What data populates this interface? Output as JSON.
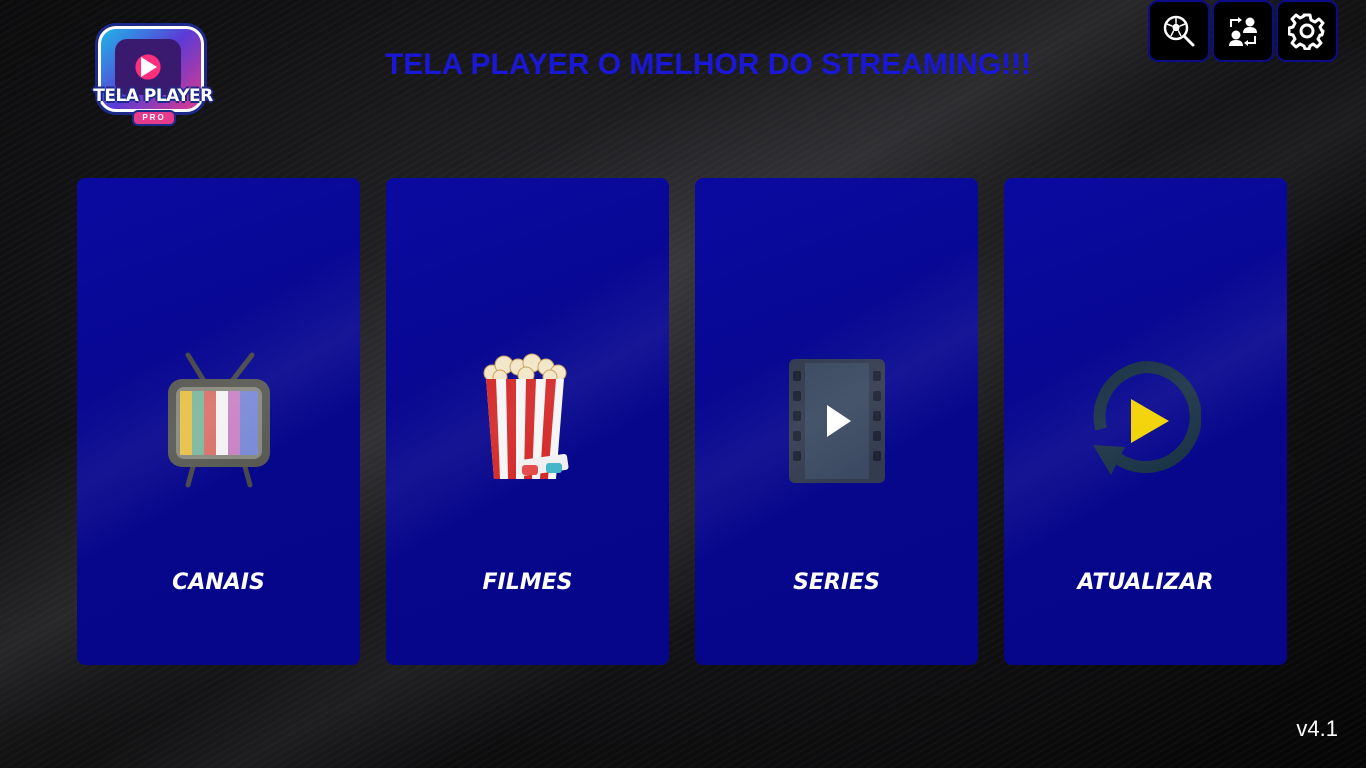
{
  "header": {
    "logo_text": "TELA PLAYER",
    "logo_badge": "PRO",
    "title": "TELA PLAYER O MELHOR DO STREAMING!!!"
  },
  "toolbar": {
    "buttons": [
      {
        "icon": "soccer-search-icon"
      },
      {
        "icon": "switch-user-icon"
      },
      {
        "icon": "gear-icon"
      }
    ]
  },
  "cards": [
    {
      "label": "CANAIS",
      "icon": "tv-icon"
    },
    {
      "label": "FILMES",
      "icon": "popcorn-icon"
    },
    {
      "label": "SERIES",
      "icon": "film-play-icon"
    },
    {
      "label": "ATUALIZAR",
      "icon": "refresh-play-icon"
    }
  ],
  "footer": {
    "version": "v4.1"
  },
  "colors": {
    "title": "#1a17d6",
    "card_bg": "#08089a",
    "button_border": "#0c0c8a",
    "background": "#050505"
  }
}
